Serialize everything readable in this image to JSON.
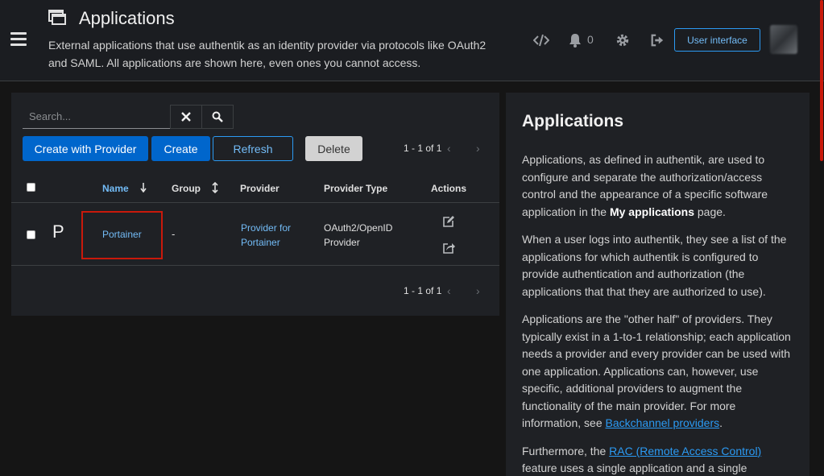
{
  "header": {
    "title": "Applications",
    "description": "External applications that use authentik as an identity provider via protocols like OAuth2 and SAML. All applications are shown here, even ones you cannot access.",
    "notification_count": "0",
    "user_interface_label": "User interface"
  },
  "toolbar": {
    "search_placeholder": "Search...",
    "create_with_provider_label": "Create with Provider",
    "create_label": "Create",
    "refresh_label": "Refresh",
    "delete_label": "Delete",
    "pagination_top": "1 - 1 of 1",
    "pagination_bottom": "1 - 1 of 1"
  },
  "table": {
    "columns": [
      "Name",
      "Group",
      "Provider",
      "Provider Type",
      "Actions"
    ],
    "rows": [
      {
        "icon_letter": "P",
        "name": "Portainer",
        "group": "-",
        "provider": "Provider for Portainer",
        "provider_type": "OAuth2/OpenID Provider"
      }
    ]
  },
  "help": {
    "title": "Applications",
    "p1_a": "Applications, as defined in authentik, are used to configure and separate the authorization/access control and the appearance of a specific software application in the ",
    "p1_bold": "My applications",
    "p1_b": " page.",
    "p2": "When a user logs into authentik, they see a list of the applications for which authentik is configured to provide authentication and authorization (the applications that that they are authorized to use).",
    "p3_a": "Applications are the \"other half\" of providers. They typically exist in a 1-to-1 relationship; each application needs a provider and every provider can be used with one application. Applications can, however, use specific, additional providers to augment the functionality of the main provider. For more information, see ",
    "p3_link": "Backchannel providers",
    "p3_b": ".",
    "p4_a": "Furthermore, the ",
    "p4_link": "RAC (Remote Access Control)",
    "p4_b": " feature uses a single application and a single"
  },
  "icons": {
    "menu": "hamburger-menu-icon",
    "app": "applications-window-icon",
    "code": "code-icon",
    "bell": "bell-icon",
    "gear": "gear-icon",
    "logout": "sign-out-icon",
    "clear": "close-icon",
    "search": "search-icon",
    "edit": "edit-icon",
    "open": "external-link-icon"
  },
  "colors": {
    "accent": "#0066cc",
    "link": "#73bcf7",
    "highlight": "#c9190b"
  }
}
